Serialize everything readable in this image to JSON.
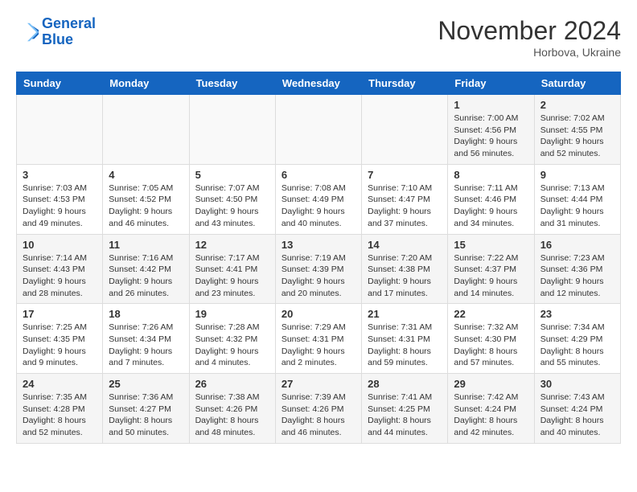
{
  "header": {
    "logo_line1": "General",
    "logo_line2": "Blue",
    "month_title": "November 2024",
    "location": "Horbova, Ukraine"
  },
  "days_of_week": [
    "Sunday",
    "Monday",
    "Tuesday",
    "Wednesday",
    "Thursday",
    "Friday",
    "Saturday"
  ],
  "weeks": [
    [
      {
        "day": "",
        "info": ""
      },
      {
        "day": "",
        "info": ""
      },
      {
        "day": "",
        "info": ""
      },
      {
        "day": "",
        "info": ""
      },
      {
        "day": "",
        "info": ""
      },
      {
        "day": "1",
        "info": "Sunrise: 7:00 AM\nSunset: 4:56 PM\nDaylight: 9 hours and 56 minutes."
      },
      {
        "day": "2",
        "info": "Sunrise: 7:02 AM\nSunset: 4:55 PM\nDaylight: 9 hours and 52 minutes."
      }
    ],
    [
      {
        "day": "3",
        "info": "Sunrise: 7:03 AM\nSunset: 4:53 PM\nDaylight: 9 hours and 49 minutes."
      },
      {
        "day": "4",
        "info": "Sunrise: 7:05 AM\nSunset: 4:52 PM\nDaylight: 9 hours and 46 minutes."
      },
      {
        "day": "5",
        "info": "Sunrise: 7:07 AM\nSunset: 4:50 PM\nDaylight: 9 hours and 43 minutes."
      },
      {
        "day": "6",
        "info": "Sunrise: 7:08 AM\nSunset: 4:49 PM\nDaylight: 9 hours and 40 minutes."
      },
      {
        "day": "7",
        "info": "Sunrise: 7:10 AM\nSunset: 4:47 PM\nDaylight: 9 hours and 37 minutes."
      },
      {
        "day": "8",
        "info": "Sunrise: 7:11 AM\nSunset: 4:46 PM\nDaylight: 9 hours and 34 minutes."
      },
      {
        "day": "9",
        "info": "Sunrise: 7:13 AM\nSunset: 4:44 PM\nDaylight: 9 hours and 31 minutes."
      }
    ],
    [
      {
        "day": "10",
        "info": "Sunrise: 7:14 AM\nSunset: 4:43 PM\nDaylight: 9 hours and 28 minutes."
      },
      {
        "day": "11",
        "info": "Sunrise: 7:16 AM\nSunset: 4:42 PM\nDaylight: 9 hours and 26 minutes."
      },
      {
        "day": "12",
        "info": "Sunrise: 7:17 AM\nSunset: 4:41 PM\nDaylight: 9 hours and 23 minutes."
      },
      {
        "day": "13",
        "info": "Sunrise: 7:19 AM\nSunset: 4:39 PM\nDaylight: 9 hours and 20 minutes."
      },
      {
        "day": "14",
        "info": "Sunrise: 7:20 AM\nSunset: 4:38 PM\nDaylight: 9 hours and 17 minutes."
      },
      {
        "day": "15",
        "info": "Sunrise: 7:22 AM\nSunset: 4:37 PM\nDaylight: 9 hours and 14 minutes."
      },
      {
        "day": "16",
        "info": "Sunrise: 7:23 AM\nSunset: 4:36 PM\nDaylight: 9 hours and 12 minutes."
      }
    ],
    [
      {
        "day": "17",
        "info": "Sunrise: 7:25 AM\nSunset: 4:35 PM\nDaylight: 9 hours and 9 minutes."
      },
      {
        "day": "18",
        "info": "Sunrise: 7:26 AM\nSunset: 4:34 PM\nDaylight: 9 hours and 7 minutes."
      },
      {
        "day": "19",
        "info": "Sunrise: 7:28 AM\nSunset: 4:32 PM\nDaylight: 9 hours and 4 minutes."
      },
      {
        "day": "20",
        "info": "Sunrise: 7:29 AM\nSunset: 4:31 PM\nDaylight: 9 hours and 2 minutes."
      },
      {
        "day": "21",
        "info": "Sunrise: 7:31 AM\nSunset: 4:31 PM\nDaylight: 8 hours and 59 minutes."
      },
      {
        "day": "22",
        "info": "Sunrise: 7:32 AM\nSunset: 4:30 PM\nDaylight: 8 hours and 57 minutes."
      },
      {
        "day": "23",
        "info": "Sunrise: 7:34 AM\nSunset: 4:29 PM\nDaylight: 8 hours and 55 minutes."
      }
    ],
    [
      {
        "day": "24",
        "info": "Sunrise: 7:35 AM\nSunset: 4:28 PM\nDaylight: 8 hours and 52 minutes."
      },
      {
        "day": "25",
        "info": "Sunrise: 7:36 AM\nSunset: 4:27 PM\nDaylight: 8 hours and 50 minutes."
      },
      {
        "day": "26",
        "info": "Sunrise: 7:38 AM\nSunset: 4:26 PM\nDaylight: 8 hours and 48 minutes."
      },
      {
        "day": "27",
        "info": "Sunrise: 7:39 AM\nSunset: 4:26 PM\nDaylight: 8 hours and 46 minutes."
      },
      {
        "day": "28",
        "info": "Sunrise: 7:41 AM\nSunset: 4:25 PM\nDaylight: 8 hours and 44 minutes."
      },
      {
        "day": "29",
        "info": "Sunrise: 7:42 AM\nSunset: 4:24 PM\nDaylight: 8 hours and 42 minutes."
      },
      {
        "day": "30",
        "info": "Sunrise: 7:43 AM\nSunset: 4:24 PM\nDaylight: 8 hours and 40 minutes."
      }
    ]
  ]
}
